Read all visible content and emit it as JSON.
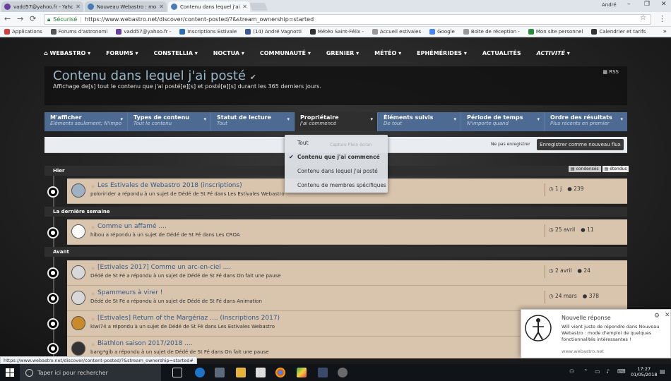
{
  "browser": {
    "tabs": [
      {
        "title": "vadd57@yahoo.fr - Yaho",
        "color": "#6b3fa0"
      },
      {
        "title": "Nouveau Webastro : mo",
        "color": "#4a7bb5"
      },
      {
        "title": "Contenu dans lequel j'ai",
        "color": "#4a7bb5"
      }
    ],
    "window_user": "André",
    "window_controls": [
      "–",
      "❐",
      "✕"
    ],
    "secure_label": "Sécurisé",
    "url": "https://www.webastro.net/discover/content-posted/?&stream_ownership=started",
    "bookmarks": [
      "Applications",
      "Forums d'astronomi",
      "vadd57@yahoo.fr -",
      "Inscriptions Estivale",
      "(14) André Vagnotti",
      "Météo Saint-Félix -",
      "Accueil estivales",
      "Google",
      "Boite de réception -",
      "Mon site personnel",
      "Calendrier et tarifs"
    ]
  },
  "nav": {
    "items": [
      "WEBASTRO",
      "FORUMS",
      "CONSTELLIA",
      "NOCTUA",
      "COMMUNAUTÉ",
      "GRENIER",
      "MÉTÉO",
      "EPHÉMÉRIDES",
      "ACTUALITÉS",
      "ACTIVITÉ"
    ]
  },
  "header": {
    "title": "Contenu dans lequel j'ai posté",
    "subtitle": "Affichage de[s] tout le contenu que j'ai posté[e][s] et posté[e][s] durant les 365 derniers jours.",
    "rss": "RSS"
  },
  "filters": [
    {
      "label": "M'afficher",
      "value": "Éléments seulement; N'impo"
    },
    {
      "label": "Types de contenu",
      "value": "Tout le contenu"
    },
    {
      "label": "Statut de lecture",
      "value": "Tout"
    },
    {
      "label": "Propriétaire",
      "value": "J'ai commencé"
    },
    {
      "label": "Éléments suivis",
      "value": "De tout"
    },
    {
      "label": "Période de temps",
      "value": "N'importe quand"
    },
    {
      "label": "Ordre des résultats",
      "value": "Plus récents en premier"
    }
  ],
  "actions": {
    "ne_pas": "Ne pas enregistrer",
    "save": "Enregistrer comme nouveau flux"
  },
  "dropdown": {
    "capture": "Capture Plein écran",
    "items": [
      "Tout",
      "Contenu que j'ai commencé",
      "Contenu dans lequel j'ai posté",
      "Contenu de membres spécifiques"
    ],
    "selected": 1
  },
  "view_toggle": {
    "condensed": "condensés",
    "expanded": "étendus"
  },
  "sections": {
    "hier": "Hier",
    "semaine": "La dernière semaine",
    "avant": "Avant"
  },
  "items": [
    {
      "title": "Les Estivales de Webastro 2018 (inscriptions)",
      "sub": "poloririder a répondu à un sujet de Dédé de St Fé dans Les Estivales Webastro",
      "time": "1 j",
      "replies": "239"
    },
    {
      "title": "Comme un affamé ....",
      "sub": "hibou a répondu à un sujet de Dédé de St Fé dans Les CROA",
      "time": "25 avril",
      "replies": "11"
    },
    {
      "title": "[Estivales 2017] Comme un arc-en-ciel ....",
      "sub": "Dédé de St Fé a répondu à un sujet de Dédé de St Fé dans On fait une pause",
      "time": "2 avril",
      "replies": "24"
    },
    {
      "title": "Spammeurs à virer !",
      "sub": "Dédé de St Fé a répondu à un sujet de Dédé de St Fé dans Animation",
      "time": "24 mars",
      "replies": "378"
    },
    {
      "title": "[Estivales] Return of the Margériaz .... (Inscriptions 2017)",
      "sub": "kiwi74 a répondu à un sujet de Dédé de St Fé dans Les Estivales Webastro",
      "time": "",
      "replies": ""
    },
    {
      "title": "Biathlon saison 2017/2018 ....",
      "sub": "bang*gib a répondu à un sujet de Dédé de St Fé dans On fait une pause",
      "time": "",
      "replies": ""
    }
  ],
  "notification": {
    "title": "Nouvelle réponse",
    "body": "Will vient juste de répondre dans Nouveau Webastro : mode d'emploi de quelques fonctionnalités intéressantes !",
    "site": "www.webastro.net"
  },
  "status_link": "https://www.webastro.net/discover/content-posted/?&stream_ownership=started#",
  "taskbar": {
    "search_placeholder": "Taper ici pour rechercher",
    "time": "17:27",
    "date": "01/05/2018"
  }
}
